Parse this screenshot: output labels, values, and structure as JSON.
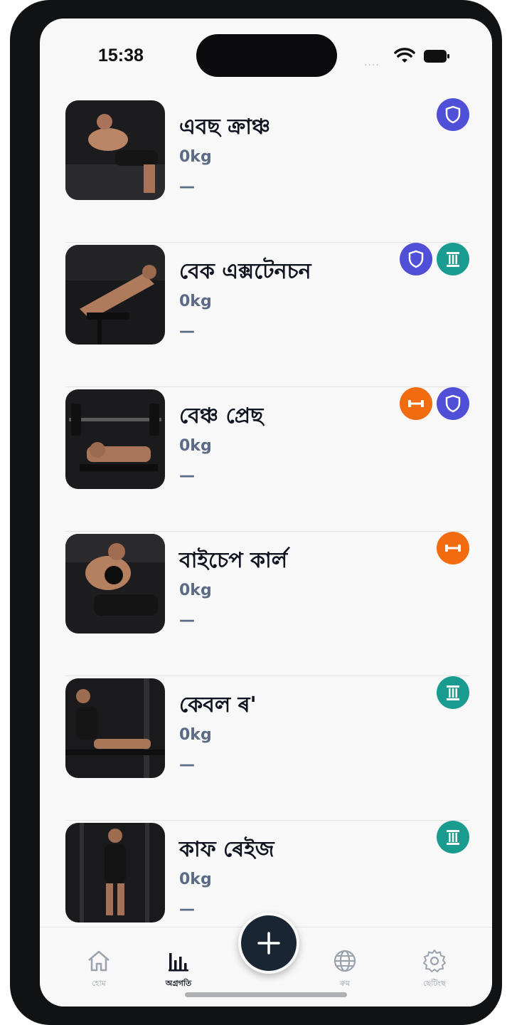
{
  "status_bar": {
    "time": "15:38",
    "signal_text": "....",
    "wifi_icon": "wifi-icon",
    "battery_icon": "battery-icon"
  },
  "exercises": [
    {
      "name": "এবছ ক্ৰাঞ্চ",
      "weight": "0kg",
      "dash": "—",
      "badges": [
        "shield"
      ]
    },
    {
      "name": "বেক এক্সটেনচন",
      "weight": "0kg",
      "dash": "—",
      "badges": [
        "shield",
        "column"
      ]
    },
    {
      "name": "বেঞ্চ প্ৰেছ",
      "weight": "0kg",
      "dash": "—",
      "badges": [
        "dumbbell",
        "shield"
      ]
    },
    {
      "name": "বাইচেপ কাৰ্ল",
      "weight": "0kg",
      "dash": "—",
      "badges": [
        "dumbbell"
      ]
    },
    {
      "name": "কেবল ৰ'",
      "weight": "0kg",
      "dash": "—",
      "badges": [
        "column"
      ]
    },
    {
      "name": "কাফ ৰেইজ",
      "weight": "0kg",
      "dash": "—",
      "badges": [
        "column"
      ]
    }
  ],
  "badge_colors": {
    "shield": "#4f4fd8",
    "column": "#199c8f",
    "dumbbell": "#f26b0f"
  },
  "tabbar": {
    "tabs": [
      {
        "label": "হোম",
        "icon": "home-icon",
        "active": false
      },
      {
        "label": "অগ্ৰগতি",
        "icon": "bar-chart-icon",
        "active": true
      },
      {
        "label": "ৰুম",
        "icon": "globe-icon",
        "active": false
      },
      {
        "label": "ছেটিংছ",
        "icon": "gear-icon",
        "active": false
      }
    ],
    "fab_icon": "plus-icon"
  }
}
